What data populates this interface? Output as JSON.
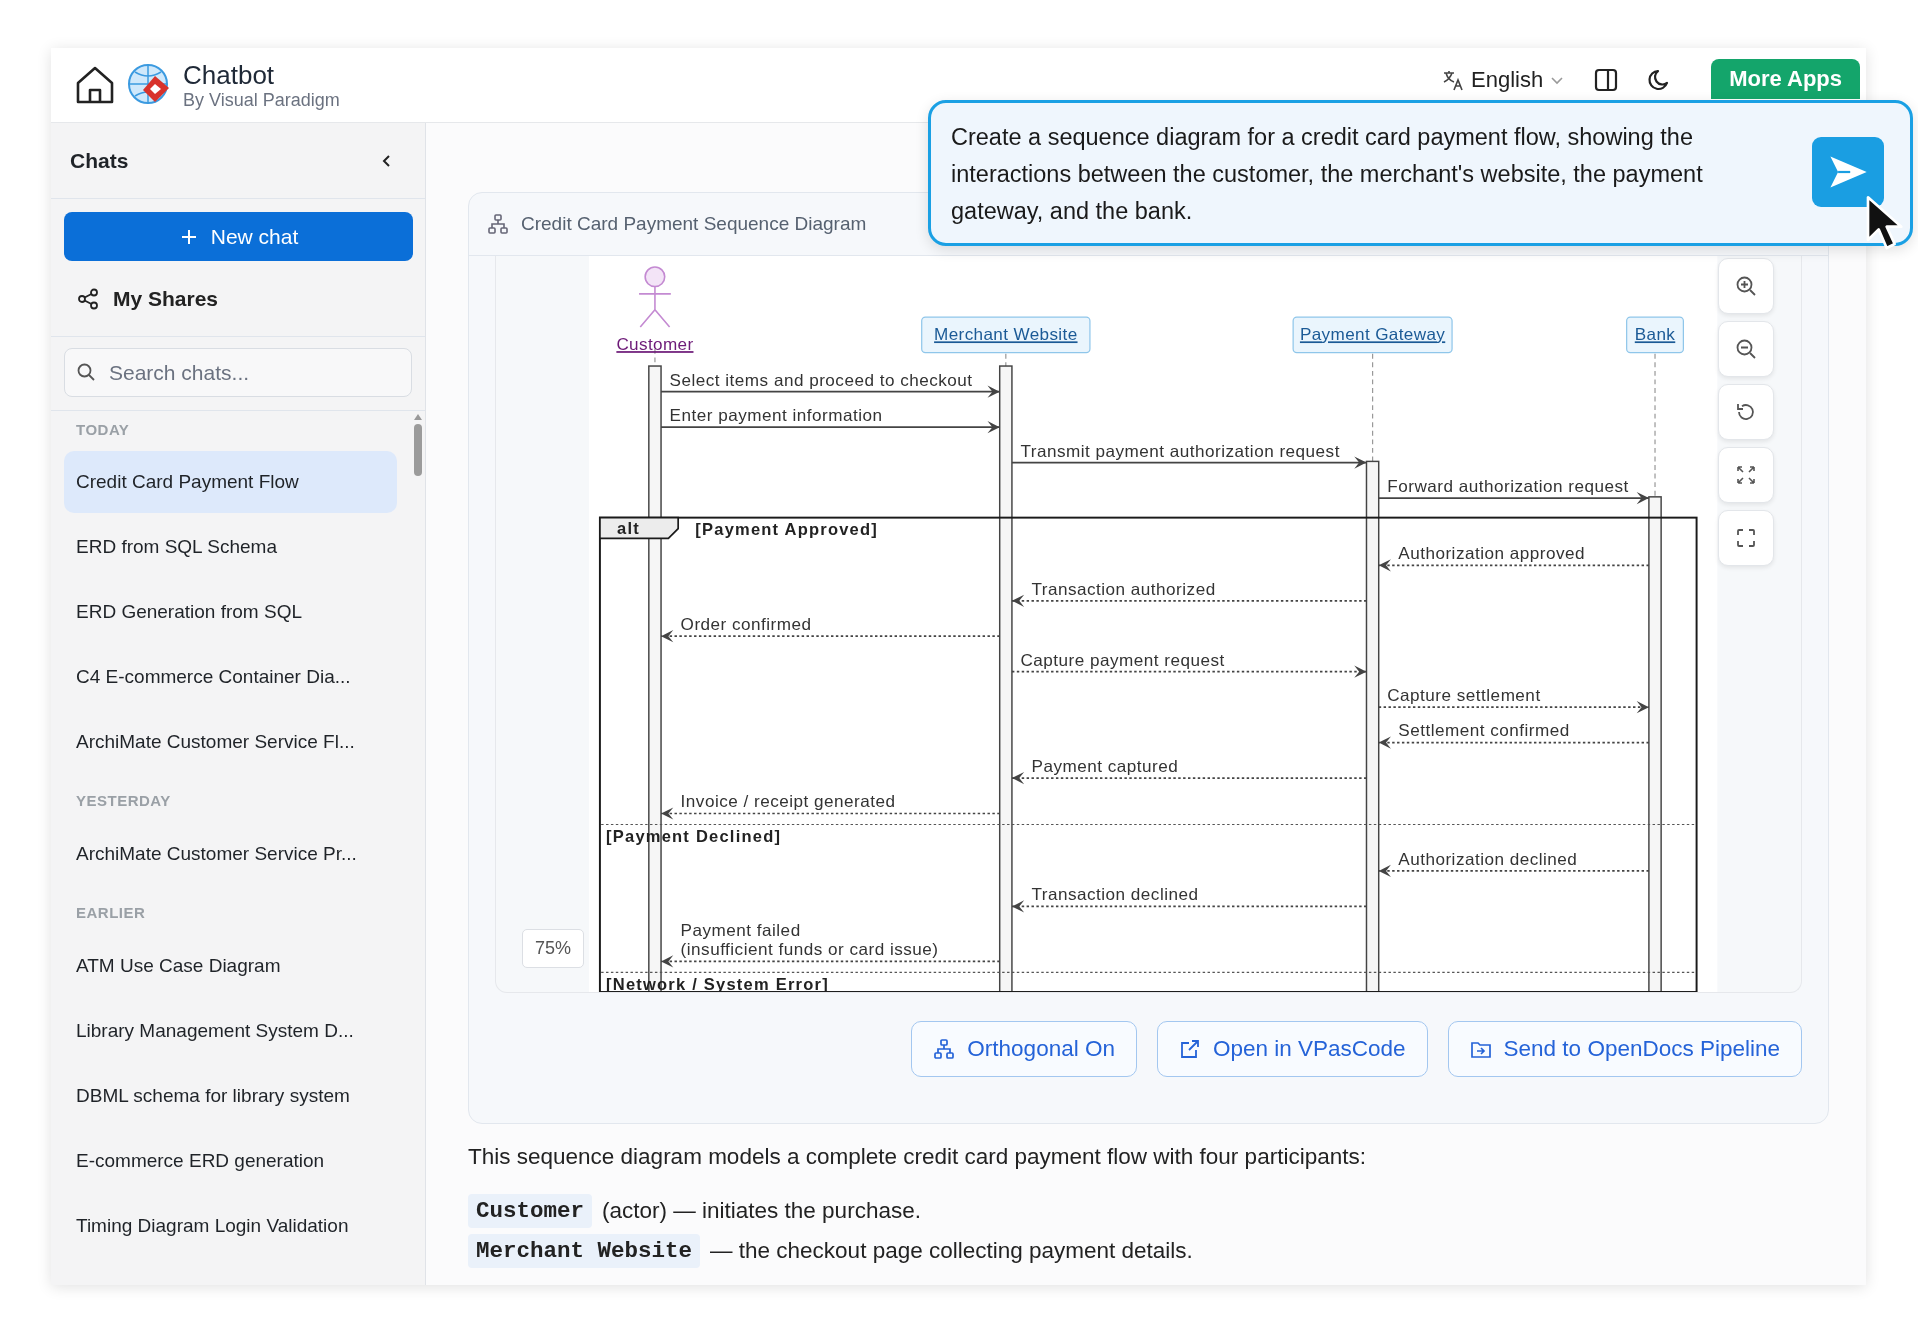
{
  "app": {
    "title": "Chatbot",
    "subtitle": "By Visual Paradigm"
  },
  "header": {
    "language": "English",
    "more_apps": "More Apps"
  },
  "sidebar": {
    "title": "Chats",
    "new_chat": "New chat",
    "my_shares": "My Shares",
    "search": {
      "placeholder": "Search chats..."
    },
    "groups": [
      {
        "label": "TODAY",
        "items": [
          {
            "label": "Credit Card Payment Flow",
            "selected": true
          },
          {
            "label": "ERD from SQL Schema",
            "selected": false
          },
          {
            "label": "ERD Generation from SQL",
            "selected": false
          },
          {
            "label": "C4 E-commerce Container Dia...",
            "selected": false
          },
          {
            "label": "ArchiMate Customer Service Fl...",
            "selected": false
          }
        ]
      },
      {
        "label": "YESTERDAY",
        "items": [
          {
            "label": "ArchiMate Customer Service Pr...",
            "selected": false
          }
        ]
      },
      {
        "label": "EARLIER",
        "items": [
          {
            "label": "ATM Use Case Diagram",
            "selected": false
          },
          {
            "label": "Library Management System D...",
            "selected": false
          },
          {
            "label": "DBML schema for library system",
            "selected": false
          },
          {
            "label": "E-commerce ERD generation",
            "selected": false
          },
          {
            "label": "Timing Diagram Login Validation",
            "selected": false
          }
        ]
      }
    ]
  },
  "diagram": {
    "title": "Credit Card Payment Sequence Diagram",
    "zoom": "75%",
    "participants": [
      {
        "name": "Customer",
        "kind": "actor"
      },
      {
        "name": "Merchant Website",
        "kind": "box"
      },
      {
        "name": "Payment Gateway",
        "kind": "box"
      },
      {
        "name": "Bank",
        "kind": "box"
      }
    ],
    "messages": [
      {
        "lines": [
          "Select items and proceed to checkout"
        ],
        "kind": "call"
      },
      {
        "lines": [
          "Enter payment information"
        ],
        "kind": "call"
      },
      {
        "lines": [
          "Transmit payment authorization request"
        ],
        "kind": "call"
      },
      {
        "lines": [
          "Forward authorization request"
        ],
        "kind": "call"
      }
    ],
    "fragment": {
      "operator": "alt",
      "sections": [
        {
          "guard": "[Payment Approved]",
          "messages": [
            {
              "lines": [
                "Authorization approved"
              ],
              "kind": "reply"
            },
            {
              "lines": [
                "Transaction authorized"
              ],
              "kind": "reply"
            },
            {
              "lines": [
                "Order confirmed"
              ],
              "kind": "reply"
            },
            {
              "lines": [
                "Capture payment request"
              ],
              "kind": "reply"
            },
            {
              "lines": [
                "Capture settlement"
              ],
              "kind": "reply"
            },
            {
              "lines": [
                "Settlement confirmed"
              ],
              "kind": "reply"
            },
            {
              "lines": [
                "Payment captured"
              ],
              "kind": "reply"
            },
            {
              "lines": [
                "Invoice / receipt generated"
              ],
              "kind": "reply"
            }
          ]
        },
        {
          "guard": "[Payment Declined]",
          "messages": [
            {
              "lines": [
                "Authorization declined"
              ],
              "kind": "reply"
            },
            {
              "lines": [
                "Transaction declined"
              ],
              "kind": "reply"
            },
            {
              "lines": [
                "Payment failed",
                "(insufficient funds or card issue)"
              ],
              "kind": "reply"
            }
          ]
        },
        {
          "guard": "[Network / System Error]"
        }
      ]
    },
    "actions": [
      {
        "label": "Orthogonal On"
      },
      {
        "label": "Open in VPasCode"
      },
      {
        "label": "Send to OpenDocs Pipeline"
      }
    ]
  },
  "description": {
    "intro": "This sequence diagram models a complete credit card payment flow with four participants:",
    "items": [
      {
        "code": "Customer",
        "text": "(actor) — initiates the purchase."
      },
      {
        "code": "Merchant Website",
        "text": "— the checkout page collecting payment details."
      }
    ]
  },
  "prompt": {
    "text": "Create a sequence diagram for a credit card payment flow, showing the interactions between the customer, the merchant's website, the payment gateway, and the bank."
  }
}
